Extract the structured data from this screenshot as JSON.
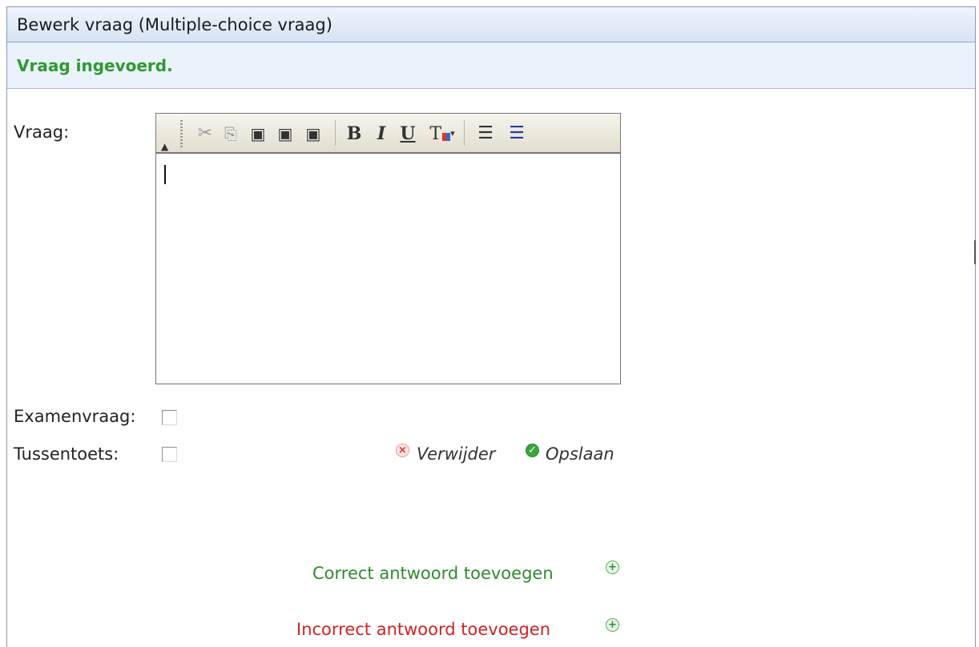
{
  "window": {
    "title": "Bewerk vraag (Multiple-choice vraag)"
  },
  "status": {
    "message": "Vraag ingevoerd.",
    "color": "#2e9a2e"
  },
  "form": {
    "question_label": "Vraag:",
    "exam_label": "Examenvraag:",
    "exam_checked": false,
    "midterm_label": "Tussentoets:",
    "midterm_checked": false,
    "editor_value": ""
  },
  "toolbar": {
    "collapse_icon": "collapse-triangle-icon",
    "items": [
      {
        "name": "cut-icon",
        "glyph": "✂"
      },
      {
        "name": "copy-icon",
        "glyph": "⎘"
      },
      {
        "name": "paste-icon",
        "glyph": "📋"
      },
      {
        "name": "paste-text-icon",
        "glyph": "📋"
      },
      {
        "name": "paste-word-icon",
        "glyph": "📋"
      },
      {
        "name": "bold-icon",
        "glyph": "B"
      },
      {
        "name": "italic-icon",
        "glyph": "I"
      },
      {
        "name": "underline-icon",
        "glyph": "U"
      },
      {
        "name": "text-color-icon",
        "glyph": "T"
      },
      {
        "name": "numbered-list-icon",
        "glyph": "☰"
      },
      {
        "name": "bullet-list-icon",
        "glyph": "☰"
      }
    ]
  },
  "actions": {
    "delete_label": "Verwijder",
    "save_label": "Opslaan"
  },
  "answers": {
    "add_correct_label": "Correct antwoord toevoegen",
    "add_correct_color": "#2e8b2e",
    "add_incorrect_label": "Incorrect antwoord toevoegen",
    "add_incorrect_color": "#d22222"
  }
}
